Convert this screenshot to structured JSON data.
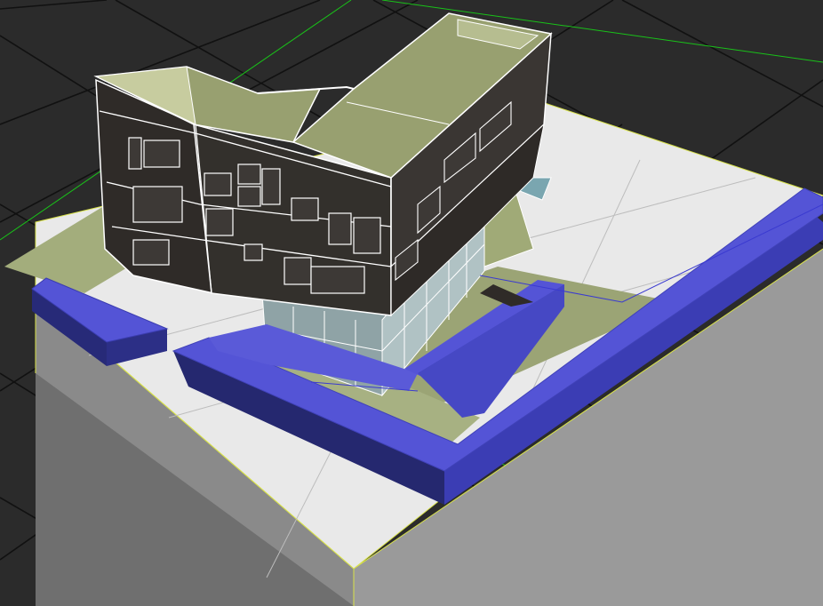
{
  "viewport": {
    "background": "#2b2b2b",
    "grid_color": "#111111",
    "axis_line_color": "#19c219",
    "selection_wire_color": "#d8e24a",
    "wireframe_edge_color": "#ffffff"
  },
  "model": {
    "base_top_color": "#e9e9e9",
    "base_side_color": "#8a8a8a",
    "lawn_color": "#9aa57a",
    "wall_color": "#5454d6",
    "wall_dark_color": "#272a78",
    "facade_color": "#2f2b28",
    "glass_color": "#8fa3a6",
    "roof_color": "#97a072"
  }
}
